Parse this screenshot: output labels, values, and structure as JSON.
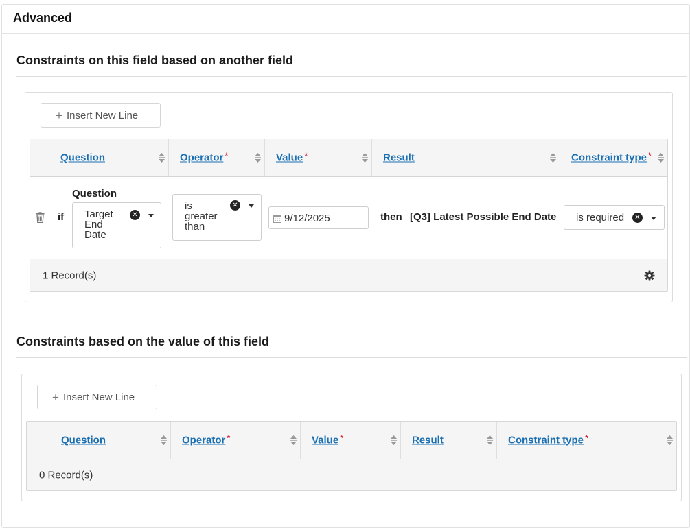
{
  "panel": {
    "title": "Advanced"
  },
  "section1": {
    "title": "Constraints on this field based on another field",
    "insert_label": "Insert New Line",
    "columns": [
      {
        "label": "Question",
        "required": false
      },
      {
        "label": "Operator",
        "required": true
      },
      {
        "label": "Value",
        "required": true
      },
      {
        "label": "Result",
        "required": false
      },
      {
        "label": "Constraint type",
        "required": true
      }
    ],
    "row": {
      "if_label": "if",
      "question_heading": "Question",
      "question_value": [
        "Target",
        "End",
        "Date"
      ],
      "operator_value": [
        "is",
        "greater",
        "than"
      ],
      "date_value": "9/12/2025",
      "then_label": "then",
      "result_value": "[Q3] Latest Possible End Date",
      "constraint_value": "is required"
    },
    "record_count": "1 Record(s)"
  },
  "section2": {
    "title": "Constraints based on the value of this field",
    "insert_label": "Insert New Line",
    "columns": [
      {
        "label": "Question",
        "required": false
      },
      {
        "label": "Operator",
        "required": true
      },
      {
        "label": "Value",
        "required": true
      },
      {
        "label": "Result",
        "required": false
      },
      {
        "label": "Constraint type",
        "required": true
      }
    ],
    "record_count": "0 Record(s)"
  },
  "required_marker": "*",
  "icons": {
    "plus": "plus-icon",
    "sort": "sort-icon",
    "trash": "trash-icon",
    "clear": "clear-icon",
    "caret": "chevron-down-icon",
    "calendar": "calendar-icon",
    "gear": "gear-icon"
  },
  "colors": {
    "link": "#1a6fb3",
    "required": "#d0021b",
    "header_bg": "#f5f5f5"
  }
}
